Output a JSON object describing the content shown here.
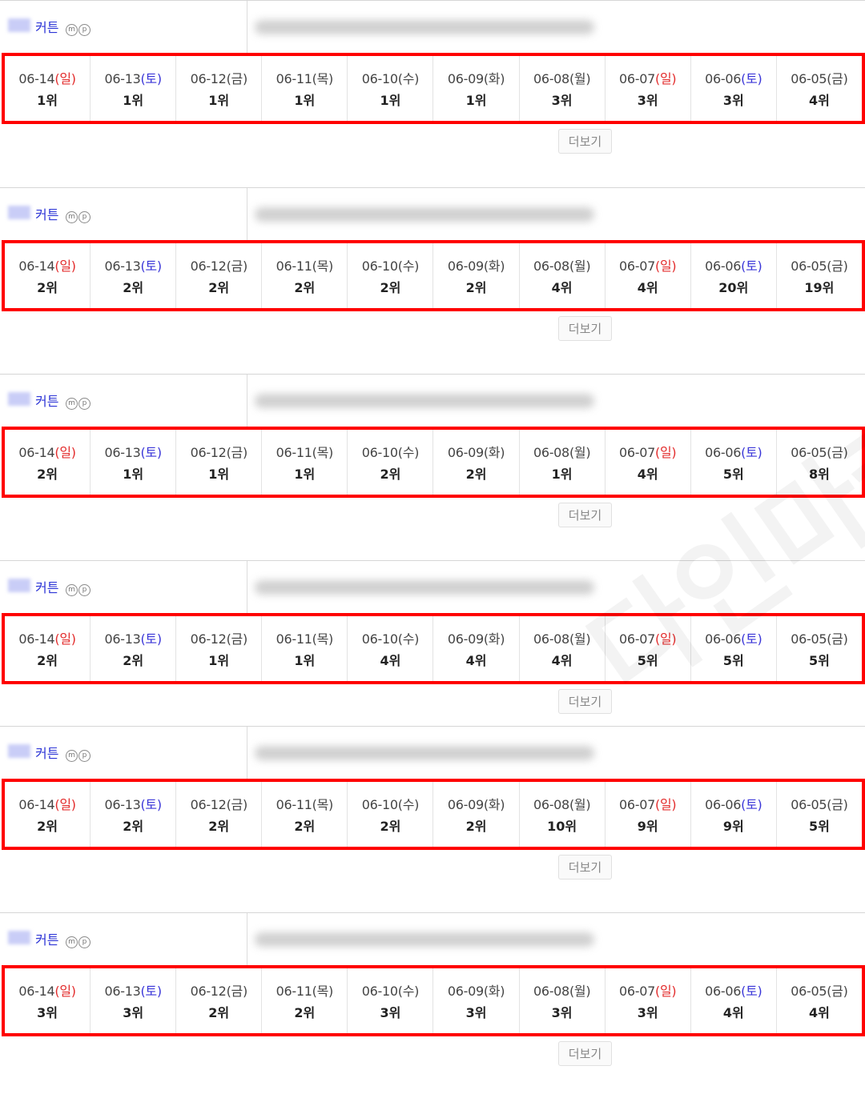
{
  "watermark": "다인마케팅",
  "more_label": "더보기",
  "badges": [
    "m",
    "p"
  ],
  "blocks": [
    {
      "keyword": "커튼",
      "days": [
        {
          "date": "06-14",
          "day": "일",
          "type": "sun",
          "rank": "1위"
        },
        {
          "date": "06-13",
          "day": "토",
          "type": "sat",
          "rank": "1위"
        },
        {
          "date": "06-12",
          "day": "금",
          "type": "wk",
          "rank": "1위"
        },
        {
          "date": "06-11",
          "day": "목",
          "type": "wk",
          "rank": "1위"
        },
        {
          "date": "06-10",
          "day": "수",
          "type": "wk",
          "rank": "1위"
        },
        {
          "date": "06-09",
          "day": "화",
          "type": "wk",
          "rank": "1위"
        },
        {
          "date": "06-08",
          "day": "월",
          "type": "wk",
          "rank": "3위"
        },
        {
          "date": "06-07",
          "day": "일",
          "type": "sun",
          "rank": "3위"
        },
        {
          "date": "06-06",
          "day": "토",
          "type": "sat",
          "rank": "3위"
        },
        {
          "date": "06-05",
          "day": "금",
          "type": "wk",
          "rank": "4위"
        }
      ]
    },
    {
      "keyword": "커튼",
      "days": [
        {
          "date": "06-14",
          "day": "일",
          "type": "sun",
          "rank": "2위"
        },
        {
          "date": "06-13",
          "day": "토",
          "type": "sat",
          "rank": "2위"
        },
        {
          "date": "06-12",
          "day": "금",
          "type": "wk",
          "rank": "2위"
        },
        {
          "date": "06-11",
          "day": "목",
          "type": "wk",
          "rank": "2위"
        },
        {
          "date": "06-10",
          "day": "수",
          "type": "wk",
          "rank": "2위"
        },
        {
          "date": "06-09",
          "day": "화",
          "type": "wk",
          "rank": "2위"
        },
        {
          "date": "06-08",
          "day": "월",
          "type": "wk",
          "rank": "4위"
        },
        {
          "date": "06-07",
          "day": "일",
          "type": "sun",
          "rank": "4위"
        },
        {
          "date": "06-06",
          "day": "토",
          "type": "sat",
          "rank": "20위"
        },
        {
          "date": "06-05",
          "day": "금",
          "type": "wk",
          "rank": "19위"
        }
      ]
    },
    {
      "keyword": "커튼",
      "days": [
        {
          "date": "06-14",
          "day": "일",
          "type": "sun",
          "rank": "2위"
        },
        {
          "date": "06-13",
          "day": "토",
          "type": "sat",
          "rank": "1위"
        },
        {
          "date": "06-12",
          "day": "금",
          "type": "wk",
          "rank": "1위"
        },
        {
          "date": "06-11",
          "day": "목",
          "type": "wk",
          "rank": "1위"
        },
        {
          "date": "06-10",
          "day": "수",
          "type": "wk",
          "rank": "2위"
        },
        {
          "date": "06-09",
          "day": "화",
          "type": "wk",
          "rank": "2위"
        },
        {
          "date": "06-08",
          "day": "월",
          "type": "wk",
          "rank": "1위"
        },
        {
          "date": "06-07",
          "day": "일",
          "type": "sun",
          "rank": "4위"
        },
        {
          "date": "06-06",
          "day": "토",
          "type": "sat",
          "rank": "5위"
        },
        {
          "date": "06-05",
          "day": "금",
          "type": "wk",
          "rank": "8위"
        }
      ]
    },
    {
      "keyword": "커튼",
      "days": [
        {
          "date": "06-14",
          "day": "일",
          "type": "sun",
          "rank": "2위"
        },
        {
          "date": "06-13",
          "day": "토",
          "type": "sat",
          "rank": "2위"
        },
        {
          "date": "06-12",
          "day": "금",
          "type": "wk",
          "rank": "1위"
        },
        {
          "date": "06-11",
          "day": "목",
          "type": "wk",
          "rank": "1위"
        },
        {
          "date": "06-10",
          "day": "수",
          "type": "wk",
          "rank": "4위"
        },
        {
          "date": "06-09",
          "day": "화",
          "type": "wk",
          "rank": "4위"
        },
        {
          "date": "06-08",
          "day": "월",
          "type": "wk",
          "rank": "4위"
        },
        {
          "date": "06-07",
          "day": "일",
          "type": "sun",
          "rank": "5위"
        },
        {
          "date": "06-06",
          "day": "토",
          "type": "sat",
          "rank": "5위"
        },
        {
          "date": "06-05",
          "day": "금",
          "type": "wk",
          "rank": "5위"
        }
      ]
    },
    {
      "keyword": "커튼",
      "days": [
        {
          "date": "06-14",
          "day": "일",
          "type": "sun",
          "rank": "2위"
        },
        {
          "date": "06-13",
          "day": "토",
          "type": "sat",
          "rank": "2위"
        },
        {
          "date": "06-12",
          "day": "금",
          "type": "wk",
          "rank": "2위"
        },
        {
          "date": "06-11",
          "day": "목",
          "type": "wk",
          "rank": "2위"
        },
        {
          "date": "06-10",
          "day": "수",
          "type": "wk",
          "rank": "2위"
        },
        {
          "date": "06-09",
          "day": "화",
          "type": "wk",
          "rank": "2위"
        },
        {
          "date": "06-08",
          "day": "월",
          "type": "wk",
          "rank": "10위"
        },
        {
          "date": "06-07",
          "day": "일",
          "type": "sun",
          "rank": "9위"
        },
        {
          "date": "06-06",
          "day": "토",
          "type": "sat",
          "rank": "9위"
        },
        {
          "date": "06-05",
          "day": "금",
          "type": "wk",
          "rank": "5위"
        }
      ]
    },
    {
      "keyword": "커튼",
      "days": [
        {
          "date": "06-14",
          "day": "일",
          "type": "sun",
          "rank": "3위"
        },
        {
          "date": "06-13",
          "day": "토",
          "type": "sat",
          "rank": "3위"
        },
        {
          "date": "06-12",
          "day": "금",
          "type": "wk",
          "rank": "2위"
        },
        {
          "date": "06-11",
          "day": "목",
          "type": "wk",
          "rank": "2위"
        },
        {
          "date": "06-10",
          "day": "수",
          "type": "wk",
          "rank": "3위"
        },
        {
          "date": "06-09",
          "day": "화",
          "type": "wk",
          "rank": "3위"
        },
        {
          "date": "06-08",
          "day": "월",
          "type": "wk",
          "rank": "3위"
        },
        {
          "date": "06-07",
          "day": "일",
          "type": "sun",
          "rank": "3위"
        },
        {
          "date": "06-06",
          "day": "토",
          "type": "sat",
          "rank": "4위"
        },
        {
          "date": "06-05",
          "day": "금",
          "type": "wk",
          "rank": "4위"
        }
      ]
    }
  ]
}
